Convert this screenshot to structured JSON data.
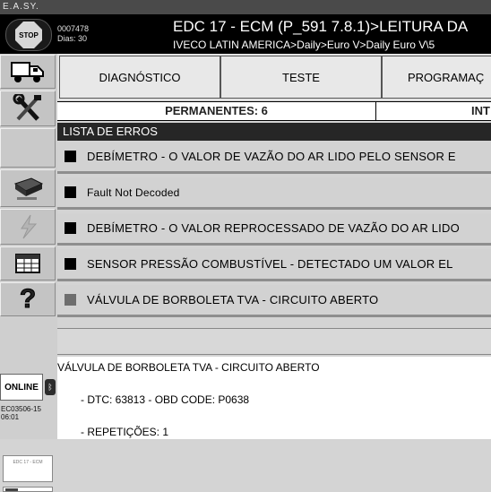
{
  "app": {
    "title": "E.A.SY."
  },
  "header": {
    "stop_label": "STOP",
    "user_code": "0007478",
    "days": "Dias: 30",
    "ecu_title": "EDC 17 - ECM (P_591 7.8.1)>LEITURA DA",
    "ecu_path": "IVECO LATIN AMERICA>Daily>Euro V>Daily Euro V\\5"
  },
  "tabs": [
    "DIAGNÓSTICO",
    "TESTE",
    "PROGRAMAÇ"
  ],
  "counters": {
    "permanent": "PERMANENTES: 6",
    "intermittent": "INT"
  },
  "error_list": {
    "title": "LISTA DE ERROS",
    "errors": [
      {
        "text": "DEBÍMETRO - O VALOR DE VAZÃO DO AR LIDO PELO SENSOR E",
        "indicator": "black"
      },
      {
        "text": "Fault Not Decoded",
        "indicator": "black"
      },
      {
        "text": "DEBÍMETRO - O VALOR REPROCESSADO DE VAZÃO DO AR LIDO",
        "indicator": "black"
      },
      {
        "text": "SENSOR PRESSÃO COMBUSTÍVEL - DETECTADO UM VALOR EL",
        "indicator": "black"
      },
      {
        "text": "VÁLVULA DE BORBOLETA TVA - CIRCUITO ABERTO",
        "indicator": "grey"
      }
    ]
  },
  "sidebar": {
    "online_label": "ONLINE",
    "ecu_date": "EC03506-15\n06:01",
    "thumb_label": "EDC 17 - ECM"
  },
  "detail": {
    "title": "VÁLVULA DE BORBOLETA TVA - CIRCUITO ABERTO",
    "dtc": "- DTC: 63813 - OBD CODE: P0638",
    "repetitions": "- REPETIÇÕES: 1"
  },
  "colors": {
    "header_bg": "#000000",
    "list_header_bg": "#262626",
    "row_bg": "#d2d2d2"
  }
}
